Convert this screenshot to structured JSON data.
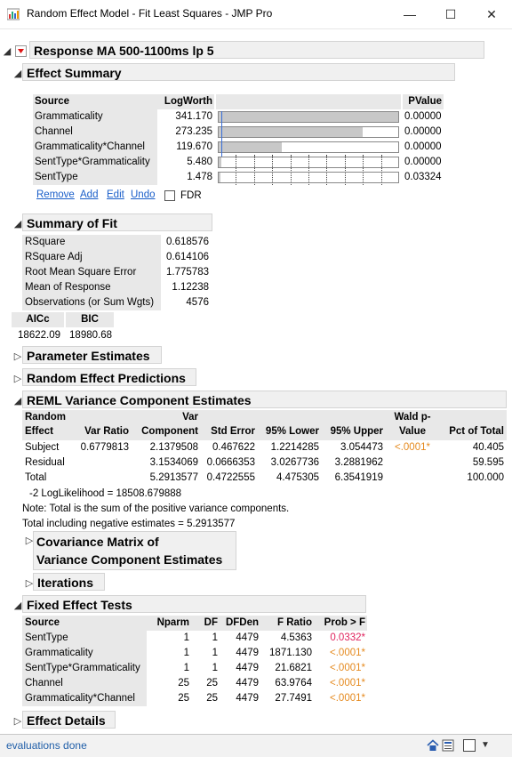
{
  "window": {
    "title": "Random Effect Model - Fit Least Squares - JMP Pro"
  },
  "report": {
    "title": "Response MA 500-1100ms lp 5"
  },
  "effect_summary": {
    "title": "Effect Summary",
    "headers": {
      "source": "Source",
      "logworth": "LogWorth",
      "pvalue": "PValue"
    },
    "rows": [
      {
        "source": "Grammaticality",
        "logworth": "341.170",
        "pvalue": "0.00000",
        "logworth_value": 341.17
      },
      {
        "source": "Channel",
        "logworth": "273.235",
        "pvalue": "0.00000",
        "logworth_value": 273.235
      },
      {
        "source": "Grammaticality*Channel",
        "logworth": "119.670",
        "pvalue": "0.00000",
        "logworth_value": 119.67
      },
      {
        "source": "SentType*Grammaticality",
        "logworth": "5.480",
        "pvalue": "0.00000",
        "logworth_value": 5.48
      },
      {
        "source": "SentType",
        "logworth": "1.478",
        "pvalue": "0.03324",
        "logworth_value": 1.478
      }
    ],
    "buttons": {
      "remove": "Remove",
      "add": "Add",
      "edit": "Edit",
      "undo": "Undo",
      "fdr": "FDR"
    }
  },
  "summary_of_fit": {
    "title": "Summary of Fit",
    "rows": [
      {
        "label": "RSquare",
        "value": "0.618576"
      },
      {
        "label": "RSquare Adj",
        "value": "0.614106"
      },
      {
        "label": "Root Mean Square Error",
        "value": "1.775783"
      },
      {
        "label": "Mean of Response",
        "value": "1.12238"
      },
      {
        "label": "Observations (or Sum Wgts)",
        "value": "4576"
      }
    ],
    "aicc_label": "AICc",
    "bic_label": "BIC",
    "aicc": "18622.09",
    "bic": "18980.68"
  },
  "collapsed": {
    "parameter_estimates": "Parameter Estimates",
    "random_effect_predictions": "Random Effect Predictions"
  },
  "reml": {
    "title": "REML Variance Component Estimates",
    "headers": {
      "random_effect": [
        "Random",
        "Effect"
      ],
      "var_ratio": "Var Ratio",
      "var_component": [
        "Var",
        "Component"
      ],
      "std_error": "Std Error",
      "lower": "95% Lower",
      "upper": "95% Upper",
      "wald": [
        "Wald p-",
        "Value"
      ],
      "pct": "Pct of Total"
    },
    "rows": [
      {
        "effect": "Subject",
        "ratio": "0.6779813",
        "comp": "2.1379508",
        "se": "0.467622",
        "lower": "1.2214285",
        "upper": "3.054473",
        "wald": "<.0001*",
        "pct": "40.405"
      },
      {
        "effect": "Residual",
        "ratio": "",
        "comp": "3.1534069",
        "se": "0.0666353",
        "lower": "3.0267736",
        "upper": "3.2881962",
        "wald": "",
        "pct": "59.595"
      },
      {
        "effect": "Total",
        "ratio": "",
        "comp": "5.2913577",
        "se": "0.4722555",
        "lower": "4.475305",
        "upper": "6.3541919",
        "wald": "",
        "pct": "100.000"
      }
    ],
    "loglik": "-2 LogLikelihood =  18508.679888",
    "note": "Note: Total is the sum of the positive variance components.",
    "total_neg": "Total including negative estimates =   5.2913577",
    "cov_matrix": [
      "Covariance Matrix of",
      "Variance Component Estimates"
    ],
    "iterations": "Iterations"
  },
  "fixed_effect_tests": {
    "title": "Fixed Effect Tests",
    "headers": {
      "source": "Source",
      "nparm": "Nparm",
      "df": "DF",
      "dfden": "DFDen",
      "fratio": "F Ratio",
      "prob": "Prob > F"
    },
    "rows": [
      {
        "source": "SentType",
        "nparm": "1",
        "df": "1",
        "dfden": "4479",
        "fratio": "4.5363",
        "prob": "0.0332*"
      },
      {
        "source": "Grammaticality",
        "nparm": "1",
        "df": "1",
        "dfden": "4479",
        "fratio": "1871.130",
        "prob": "<.0001*"
      },
      {
        "source": "SentType*Grammaticality",
        "nparm": "1",
        "df": "1",
        "dfden": "4479",
        "fratio": "21.6821",
        "prob": "<.0001*"
      },
      {
        "source": "Channel",
        "nparm": "25",
        "df": "25",
        "dfden": "4479",
        "fratio": "63.9764",
        "prob": "<.0001*"
      },
      {
        "source": "Grammaticality*Channel",
        "nparm": "25",
        "df": "25",
        "dfden": "4479",
        "fratio": "27.7491",
        "prob": "<.0001*"
      }
    ]
  },
  "effect_details": "Effect Details",
  "status": {
    "text": "evaluations done"
  },
  "colors": {
    "significant_red": "#e0245e",
    "significant_orange": "#e58a1f",
    "link": "#1a5ec9"
  }
}
